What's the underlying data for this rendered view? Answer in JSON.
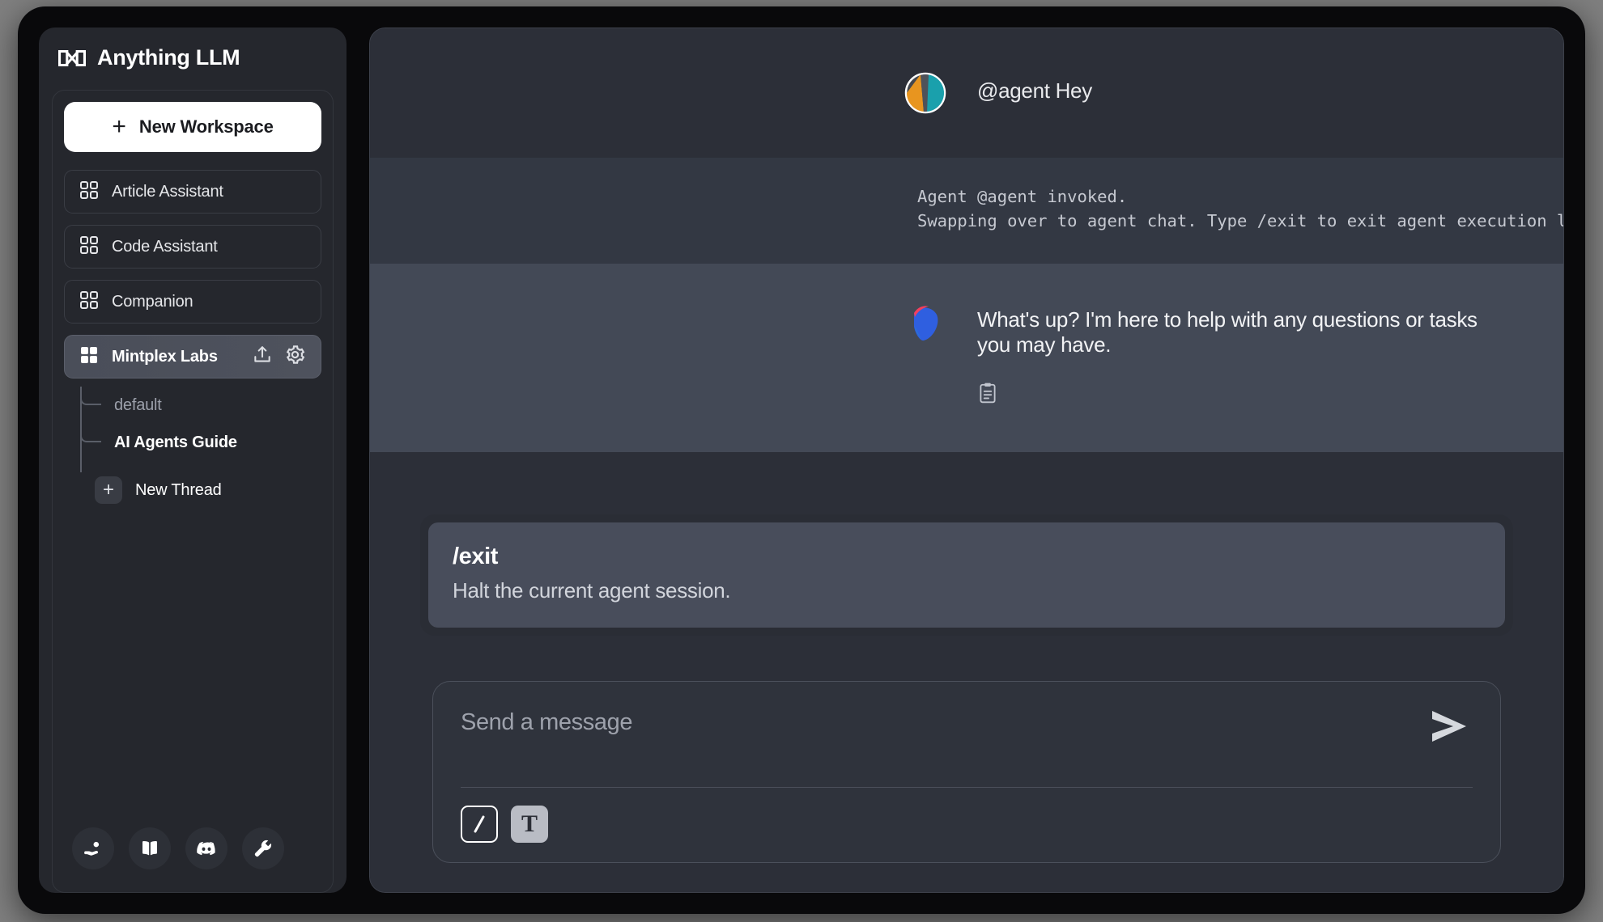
{
  "app": {
    "brand_name": "Anything LLM",
    "brand_logo_icon": "anythingllm-logo-icon"
  },
  "sidebar": {
    "new_workspace": {
      "label": "New Workspace",
      "icon": "plus-icon"
    },
    "workspaces": [
      {
        "label": "Article Assistant",
        "icon": "squares-four-icon",
        "active": false
      },
      {
        "label": "Code Assistant",
        "icon": "squares-four-icon",
        "active": false
      },
      {
        "label": "Companion",
        "icon": "squares-four-icon",
        "active": false
      },
      {
        "label": "Mintplex Labs",
        "icon": "squares-four-filled-icon",
        "active": true
      }
    ],
    "active_workspace_actions": [
      {
        "name": "upload-icon"
      },
      {
        "name": "gear-icon"
      }
    ],
    "threads": [
      {
        "label": "default",
        "current": false
      },
      {
        "label": "AI Agents Guide",
        "current": true
      }
    ],
    "new_thread": {
      "label": "New Thread",
      "icon": "plus-icon"
    },
    "footer_icons": [
      {
        "name": "hand-coin-icon",
        "title": "Support"
      },
      {
        "name": "book-open-icon",
        "title": "Docs"
      },
      {
        "name": "discord-icon",
        "title": "Discord"
      },
      {
        "name": "wrench-icon",
        "title": "Settings"
      }
    ]
  },
  "chat": {
    "messages": [
      {
        "role": "user",
        "avatar_icon": "user-avatar-icon",
        "text": "@agent Hey"
      },
      {
        "role": "system",
        "text_line_1": "Agent @agent invoked.",
        "text_line_2": "Swapping over to agent chat. Type /exit to exit agent execution loop early."
      },
      {
        "role": "assistant",
        "avatar_icon": "anythingllm-avatar-icon",
        "text": "What's up? I'm here to help with any questions or tasks you may have.",
        "actions": [
          {
            "name": "copy-icon"
          }
        ]
      }
    ]
  },
  "slash_popup": {
    "command": "/exit",
    "description": "Halt the current agent session."
  },
  "composer": {
    "placeholder": "Send a message",
    "value": "",
    "send_icon": "send-icon",
    "tools": [
      {
        "name": "slash-command-button",
        "glyph": "/",
        "active": true
      },
      {
        "name": "text-format-button",
        "glyph": "T",
        "active": false
      }
    ]
  },
  "colors": {
    "page_background": "#7f7f7f",
    "window_frame": "#09090b",
    "sidebar_background": "#25272d",
    "chat_background": "#2c2f38",
    "system_row_background": "#333843",
    "assistant_row_background": "#434956",
    "accent_white": "#ffffff",
    "avatar_orange": "#e8951f",
    "avatar_teal": "#1aa0ac",
    "logo_blue": "#2f5fe0",
    "logo_pink": "#f43f5e"
  }
}
